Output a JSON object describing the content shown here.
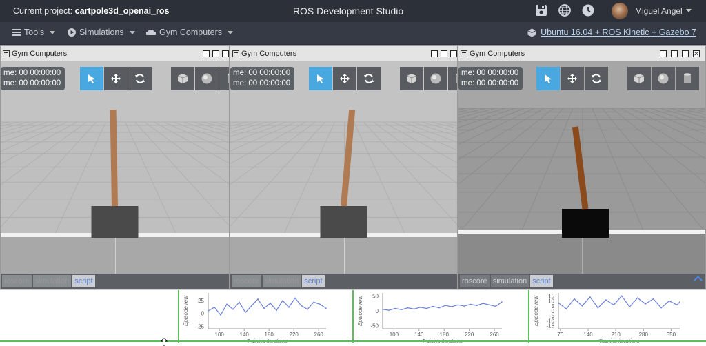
{
  "topbar": {
    "project_label": "Current project:",
    "project_name": "cartpole3d_openai_ros",
    "title": "ROS Development Studio",
    "user": "Miguel Angel",
    "icons": [
      "save-icon",
      "globe-icon",
      "clock-icon"
    ]
  },
  "menubar": {
    "tools": "Tools",
    "simulations": "Simulations",
    "gym": "Gym Computers",
    "env": "Ubuntu 16.04 + ROS Kinetic + Gazebo 7"
  },
  "panels": [
    {
      "title": "Gym Computers",
      "clock1": "me: 00 00:00:00",
      "clock2": "me: 00 00:00:00",
      "tabs": [
        "roscore",
        "simulation",
        "script"
      ],
      "active_tab": "script",
      "pole_angle_deg": 1
    },
    {
      "title": "Gym Computers",
      "clock1": "me: 00 00:00:00",
      "clock2": "me: 00 00:00:00",
      "tabs": [
        "roscore",
        "simulation",
        "script"
      ],
      "active_tab": "script",
      "pole_angle_deg": -5
    },
    {
      "title": "Gym Computers",
      "clock1": "me: 00 00:00:00",
      "clock2": "me: 00 00:00:00",
      "tabs": [
        "roscore",
        "simulation",
        "script"
      ],
      "active_tab": "script",
      "pole_angle_deg": 7
    }
  ],
  "chart_data": [
    {
      "type": "line",
      "xlabel": "Training iterations",
      "ylabel": "Episode rew",
      "ytick_labels": [
        "25",
        "0",
        "-25"
      ],
      "yticks": [
        25,
        0,
        -25
      ],
      "xticks": [
        100,
        140,
        180,
        220,
        260
      ],
      "xlim": [
        82,
        272
      ],
      "ylim": [
        -30,
        40
      ],
      "x": [
        82,
        92,
        102,
        112,
        122,
        132,
        142,
        152,
        162,
        172,
        182,
        192,
        202,
        212,
        222,
        232,
        242,
        252,
        262,
        272
      ],
      "y": [
        5,
        12,
        -3,
        18,
        8,
        22,
        2,
        15,
        28,
        10,
        20,
        6,
        25,
        12,
        30,
        15,
        8,
        22,
        18,
        10
      ]
    },
    {
      "type": "line",
      "xlabel": "Training iterations",
      "ylabel": "Episode rew",
      "ytick_labels": [
        "50",
        "0",
        "-50"
      ],
      "yticks": [
        50,
        0,
        -50
      ],
      "xticks": [
        100,
        140,
        180,
        220,
        260
      ],
      "xlim": [
        82,
        272
      ],
      "ylim": [
        -60,
        60
      ],
      "x": [
        82,
        92,
        102,
        112,
        122,
        132,
        142,
        152,
        162,
        172,
        182,
        192,
        202,
        212,
        222,
        232,
        242,
        252,
        262,
        272
      ],
      "y": [
        5,
        2,
        8,
        4,
        10,
        6,
        12,
        8,
        15,
        10,
        18,
        14,
        20,
        16,
        22,
        18,
        25,
        20,
        15,
        30
      ]
    },
    {
      "type": "line",
      "xlabel": "Training iterations",
      "ylabel": "Episode rew",
      "ytick_labels": [
        "15",
        "10",
        "5",
        "0",
        "-5",
        "-10",
        "-15"
      ],
      "yticks": [
        15,
        10,
        5,
        0,
        -5,
        -10,
        -15
      ],
      "xticks": [
        70,
        140,
        210,
        280,
        350
      ],
      "xlim": [
        65,
        372
      ],
      "ylim": [
        -18,
        18
      ],
      "x": [
        65,
        85,
        105,
        125,
        145,
        165,
        185,
        205,
        225,
        245,
        265,
        285,
        305,
        325,
        345,
        365,
        372
      ],
      "y": [
        8,
        2,
        12,
        5,
        14,
        3,
        11,
        6,
        15,
        4,
        13,
        7,
        12,
        3,
        10,
        6,
        9
      ]
    }
  ]
}
